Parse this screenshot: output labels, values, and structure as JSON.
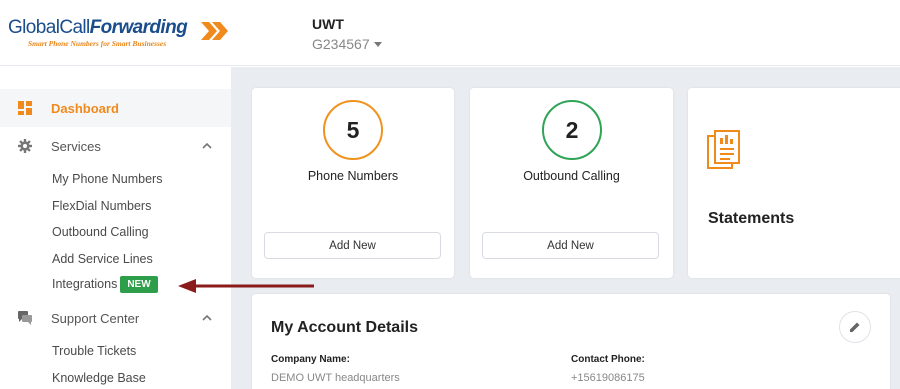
{
  "brand": {
    "logo_part1": "Global",
    "logo_part2": "Call",
    "logo_part3": "Forwarding",
    "tagline": "Smart Phone Numbers for Smart Businesses",
    "orange": "#f08a1c",
    "blue": "#1a4d8c"
  },
  "account": {
    "name": "UWT",
    "id": "G234567"
  },
  "sidebar": {
    "dashboard": "Dashboard",
    "services": {
      "label": "Services",
      "items": [
        "My Phone Numbers",
        "FlexDial Numbers",
        "Outbound Calling",
        "Add Service Lines",
        "Integrations"
      ],
      "integrations_badge": "NEW"
    },
    "support": {
      "label": "Support Center",
      "items": [
        "Trouble Tickets",
        "Knowledge Base"
      ]
    }
  },
  "cards": {
    "phone_numbers": {
      "count": "5",
      "title": "Phone Numbers",
      "button": "Add New",
      "ring_color": "#f0921e"
    },
    "outbound_calling": {
      "count": "2",
      "title": "Outbound Calling",
      "button": "Add New",
      "ring_color": "#2fa356"
    },
    "statements": {
      "title": "Statements"
    }
  },
  "account_details": {
    "title": "My Account Details",
    "company_label": "Company Name:",
    "company_value": "DEMO UWT headquarters",
    "phone_label": "Contact Phone:",
    "phone_value": "+15619086175"
  },
  "icons": {
    "dashboard": "dashboard-icon",
    "services": "gear-icon",
    "support": "chat-icon",
    "statements": "document-icon",
    "edit": "pencil-icon"
  }
}
